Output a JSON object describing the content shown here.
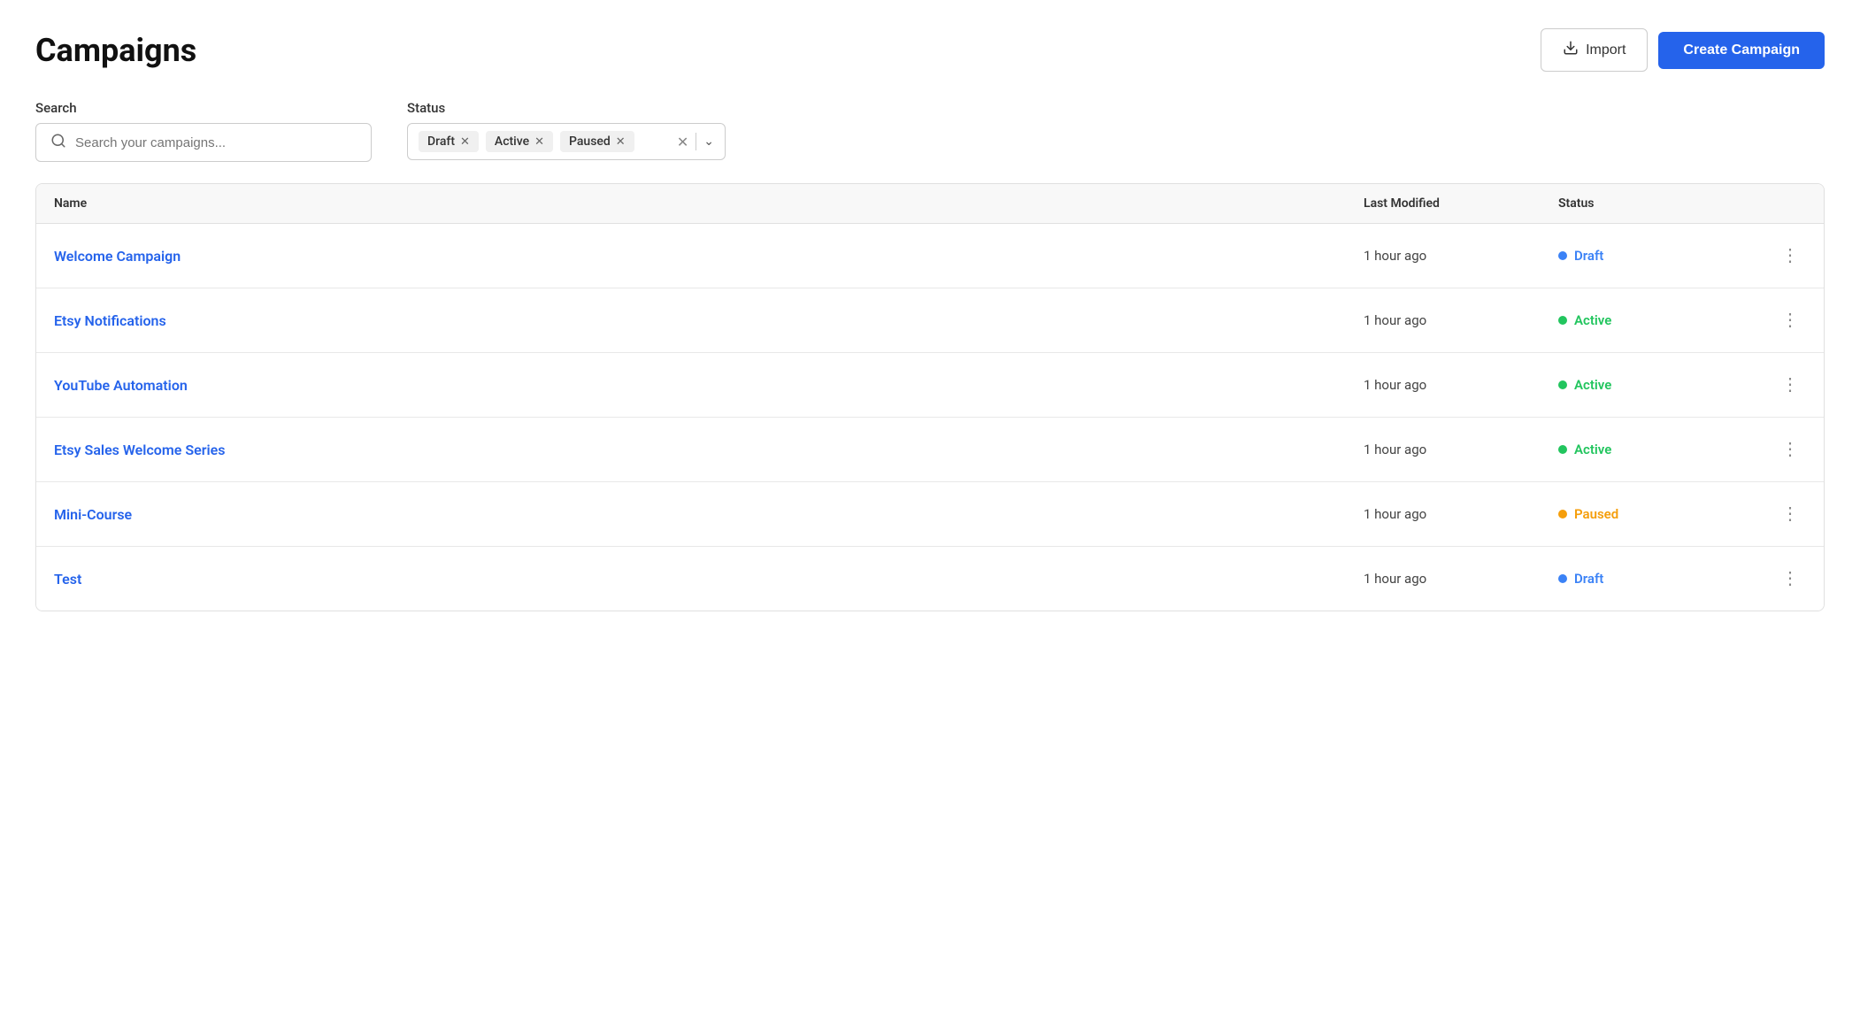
{
  "header": {
    "title": "Campaigns",
    "import_label": "Import",
    "create_label": "Create Campaign"
  },
  "filters": {
    "search_label": "Search",
    "search_placeholder": "Search your campaigns...",
    "status_label": "Status",
    "status_tags": [
      {
        "id": "draft",
        "label": "Draft"
      },
      {
        "id": "active",
        "label": "Active"
      },
      {
        "id": "paused",
        "label": "Paused"
      }
    ]
  },
  "table": {
    "columns": {
      "name": "Name",
      "last_modified": "Last Modified",
      "status": "Status"
    },
    "rows": [
      {
        "id": 1,
        "name": "Welcome Campaign",
        "last_modified": "1 hour ago",
        "status": "Draft",
        "status_class": "draft"
      },
      {
        "id": 2,
        "name": "Etsy Notifications",
        "last_modified": "1 hour ago",
        "status": "Active",
        "status_class": "active"
      },
      {
        "id": 3,
        "name": "YouTube Automation",
        "last_modified": "1 hour ago",
        "status": "Active",
        "status_class": "active"
      },
      {
        "id": 4,
        "name": "Etsy Sales Welcome Series",
        "last_modified": "1 hour ago",
        "status": "Active",
        "status_class": "active"
      },
      {
        "id": 5,
        "name": "Mini-Course",
        "last_modified": "1 hour ago",
        "status": "Paused",
        "status_class": "paused"
      },
      {
        "id": 6,
        "name": "Test",
        "last_modified": "1 hour ago",
        "status": "Draft",
        "status_class": "draft"
      }
    ]
  }
}
